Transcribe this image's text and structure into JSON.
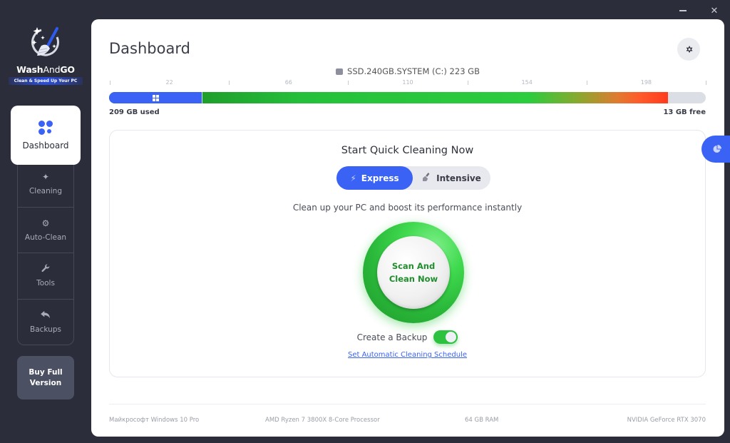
{
  "window": {
    "minimize_label": "minimize",
    "close_label": "✕"
  },
  "brand": {
    "name_bold1": "Wash",
    "name_thin": "And",
    "name_bold2": "GO",
    "tagline": "Clean & Speed Up Your PC"
  },
  "sidebar": {
    "active": {
      "label": "Dashboard",
      "icon": "dashboard-icon"
    },
    "items": [
      {
        "label": "Cleaning",
        "icon": "sparkle-icon",
        "glyph": "✦"
      },
      {
        "label": "Auto-Clean",
        "icon": "gear-icon",
        "glyph": "⚙"
      },
      {
        "label": "Tools",
        "icon": "wrench-icon",
        "glyph": "🔧"
      },
      {
        "label": "Backups",
        "icon": "reply-arrow-icon",
        "glyph": "↶"
      }
    ],
    "buy_button": "Buy Full Version"
  },
  "header": {
    "title": "Dashboard",
    "settings_icon": "gear-icon"
  },
  "drive": {
    "label": "SSD.240GB.SYSTEM (C:) 223 GB",
    "total_gb": 223,
    "system_gb": 35,
    "used_gb": 209,
    "free_gb": 13,
    "tick_labels": [
      "22",
      "66",
      "110",
      "154",
      "198"
    ],
    "used_label": "209 GB used",
    "free_label": "13 GB free",
    "colors": {
      "system": "#3a62f5",
      "used_start": "#1f9e2c",
      "used_end": "#ff3b1f",
      "free": "#dcdee5"
    }
  },
  "quick_clean": {
    "title": "Start Quick Cleaning Now",
    "modes": [
      {
        "label": "Express",
        "icon": "lightning-icon",
        "selected": true
      },
      {
        "label": "Intensive",
        "icon": "brush-icon",
        "selected": false
      }
    ],
    "subtitle": "Clean up your PC and boost its performance instantly",
    "scan_button": "Scan And Clean Now",
    "backup_label": "Create a Backup",
    "backup_enabled": true,
    "schedule_link": "Set Automatic Cleaning Schedule"
  },
  "system_info": {
    "os": "Майкрософт Windows 10 Pro",
    "cpu": "AMD Ryzen 7 3800X 8-Core Processor",
    "ram": "64 GB RAM",
    "gpu": "NVIDIA GeForce RTX 3070"
  },
  "side_tab": {
    "icon": "pie-chart-icon"
  }
}
